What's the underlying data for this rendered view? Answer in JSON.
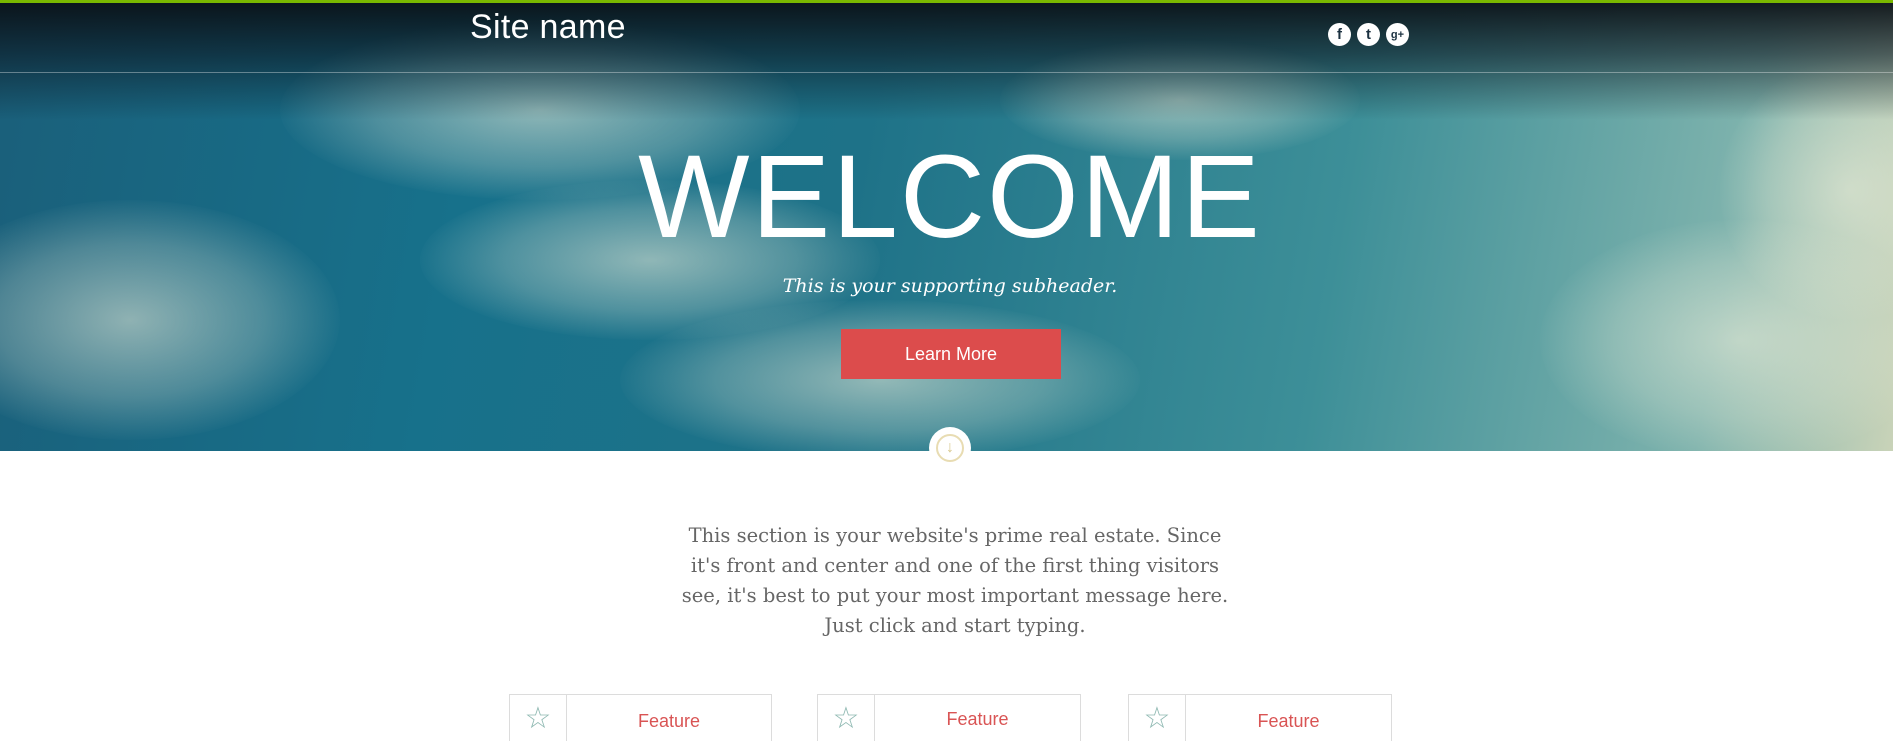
{
  "header": {
    "site_name": "Site name",
    "social_icons": [
      "facebook-icon",
      "twitter-icon",
      "google-plus-icon"
    ],
    "social_glyphs": [
      "f",
      "t",
      "g+"
    ]
  },
  "hero": {
    "title": "WELCOME",
    "subheader": "This is your supporting subheader.",
    "button_label": "Learn More",
    "scroll_icon": "↓"
  },
  "intro": {
    "text": "This section is your website's prime real estate. Since it's front and center and one of the first thing visitors see, it's best to put your most important message here. Just click and start typing."
  },
  "features": [
    {
      "icon": "☆",
      "label": "Feature"
    },
    {
      "icon": "☆",
      "label": "Feature"
    },
    {
      "icon": "☆",
      "label": "Feature"
    }
  ],
  "colors": {
    "accent_green": "#7ab800",
    "button_red": "#dc4c4c",
    "feature_red": "#d95454",
    "star_teal": "#8fb9b2"
  }
}
